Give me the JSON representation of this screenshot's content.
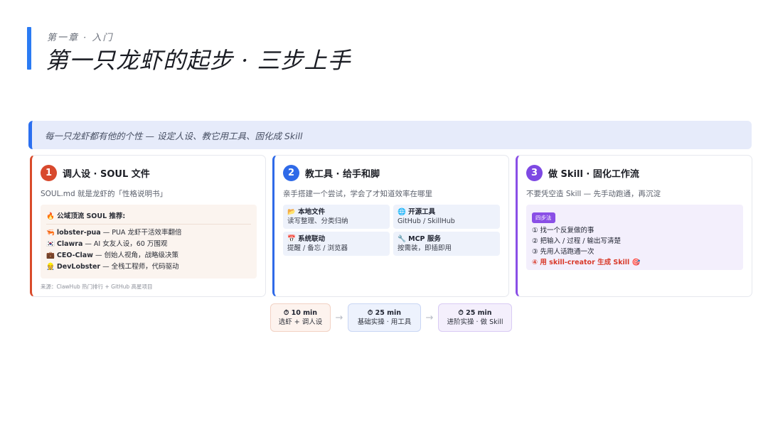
{
  "header": {
    "chapter": "第一章 · 入门",
    "title": "第一只龙虾的起步 · 三步上手"
  },
  "banner": {
    "text": "每一只龙虾都有他的个性 — 设定人设、教它用工具、固化成 Skill"
  },
  "colors": {
    "accent": "#2b7bf3",
    "step1": "#d8492d",
    "step2": "#2f6ae8",
    "step3": "#7e49e3",
    "highlight": "#d83a2a"
  },
  "cards": [
    {
      "num": "1",
      "title": "调人设 · SOUL 文件",
      "subtitle": "SOUL.md 就是龙虾的「性格说明书」",
      "box_title": "🔥 公域顶流 SOUL 推荐:",
      "items": [
        {
          "icon": "🦐",
          "name": "lobster-pua",
          "desc": " — PUA 龙虾干活效率翻倍"
        },
        {
          "icon": "🇰🇷",
          "name": "Clawra",
          "desc": " — AI 女友人设，60 万围观"
        },
        {
          "icon": "💼",
          "name": "CEO-Claw",
          "desc": " — 创始人视角，战略级决策"
        },
        {
          "icon": "👷",
          "name": "DevLobster",
          "desc": " — 全栈工程师，代码驱动"
        }
      ],
      "source": "来源：ClawHub 热门排行 + GitHub 高星项目"
    },
    {
      "num": "2",
      "title": "教工具 · 给手和脚",
      "subtitle": "亲手搭建一个尝试，学会了才知道效率在哪里",
      "tools": [
        {
          "title": "📂 本地文件",
          "desc": "读写整理、分类归纳"
        },
        {
          "title": "🌐 开源工具",
          "desc": "GitHub / SkillHub"
        },
        {
          "title": "📅 系统联动",
          "desc": "提醒 / 备忘 / 浏览器"
        },
        {
          "title": "🔧 MCP 服务",
          "desc": "按需装，即插即用"
        }
      ]
    },
    {
      "num": "3",
      "title": "做 Skill · 固化工作流",
      "subtitle": "不要凭空造 Skill — 先手动跑通，再沉淀",
      "badge": "四步法",
      "steps": [
        "① 找一个反复做的事",
        "② 把输入 / 过程 / 输出写清楚",
        "③ 先用人话跑通一次",
        "④ 用 skill-creator 生成 Skill 🎯"
      ]
    }
  ],
  "timeline": [
    {
      "time": "⏱ 10 min",
      "label": "选虾 + 调人设"
    },
    {
      "time": "⏱ 25 min",
      "label": "基础实操 · 用工具"
    },
    {
      "time": "⏱ 25 min",
      "label": "进阶实操 · 做 Skill"
    }
  ],
  "arrow": "→"
}
